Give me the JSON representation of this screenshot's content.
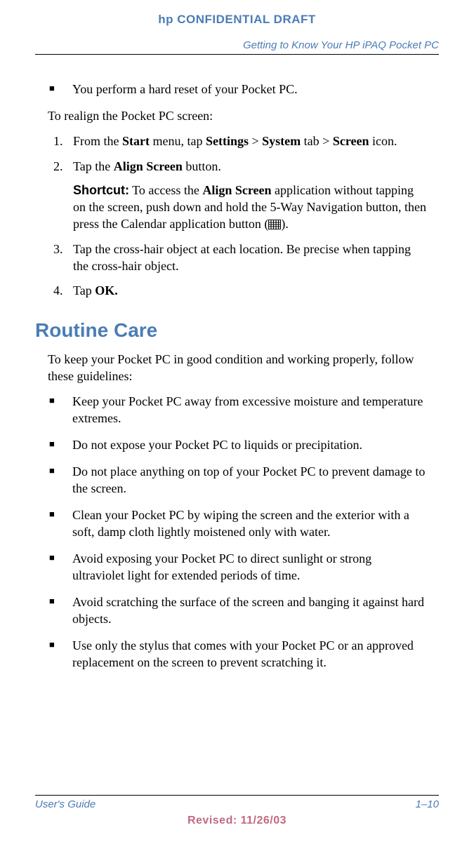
{
  "header": {
    "label": "hp CONFIDENTIAL DRAFT",
    "doc_title": "Getting to Know Your HP iPAQ Pocket PC"
  },
  "top_bullets": [
    "You perform a hard reset of your Pocket PC."
  ],
  "realign_intro": "To realign the Pocket PC screen:",
  "steps": {
    "s1_prefix": "From the ",
    "s1_b1": "Start",
    "s1_mid1": " menu, tap ",
    "s1_b2": "Settings",
    "s1_mid2": " > ",
    "s1_b3": "System",
    "s1_mid3": " tab > ",
    "s1_b4": "Screen",
    "s1_suffix": " icon.",
    "s2_prefix": "Tap the ",
    "s2_b1": "Align Screen",
    "s2_suffix": " button.",
    "s2_shortcut_label": "Shortcut:",
    "s2_shortcut_pre": " To access the ",
    "s2_shortcut_b1": "Align Screen",
    "s2_shortcut_post": " application without tapping on the screen, push down and hold the 5-Way Navigation button, then press the Calendar application button  (",
    "s2_shortcut_close": ").",
    "s3": "Tap the cross-hair object at each location. Be precise when tapping the cross-hair object.",
    "s4_prefix": "Tap ",
    "s4_b1": "OK."
  },
  "routine": {
    "heading": "Routine Care",
    "intro": "To keep your Pocket PC in good condition and working properly, follow these guidelines:",
    "bullets": [
      "Keep your Pocket PC away from excessive moisture and temperature extremes.",
      "Do not expose your Pocket PC to liquids or precipitation.",
      "Do not place anything on top of your Pocket PC to prevent damage to the screen.",
      "Clean your Pocket PC by wiping the screen and the exterior with a soft, damp cloth lightly moistened only with water.",
      "Avoid exposing your Pocket PC to direct sunlight or strong ultraviolet light for extended periods of time.",
      "Avoid scratching the surface of the screen and banging it against hard objects.",
      "Use only the stylus that comes with your Pocket PC or an approved replacement on the screen to prevent scratching it."
    ]
  },
  "footer": {
    "guide": "User's Guide",
    "page": "1–10",
    "revised": "Revised: 11/26/03"
  }
}
